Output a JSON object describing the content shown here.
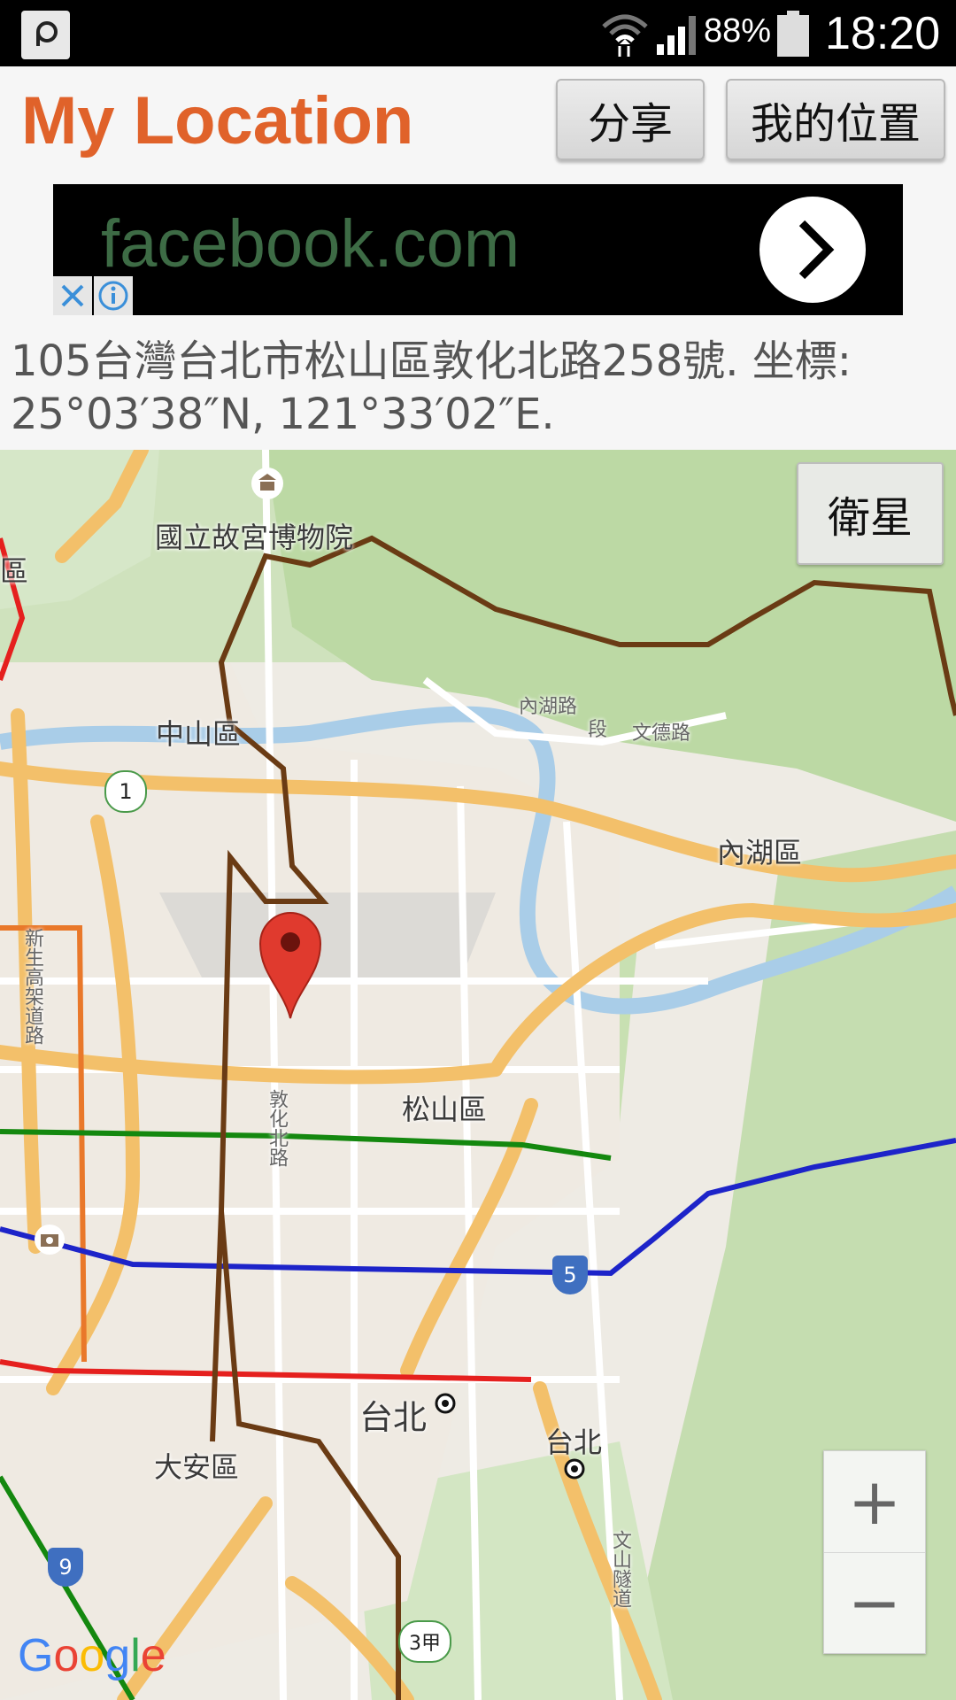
{
  "status_bar": {
    "battery": "88%",
    "time": "18:20"
  },
  "header": {
    "title": "My Location",
    "share_label": "分享",
    "my_location_label": "我的位置"
  },
  "ad": {
    "text": "facebook.com"
  },
  "address": "105台灣台北市松山區敦化北路258號. 坐標: 25°03′38″N, 121°33′02″E.",
  "map": {
    "satellite_label": "衛星",
    "labels": {
      "palace": "國立故宮博物院",
      "zhongshan": "中山區",
      "neihu": "內湖區",
      "songshan": "松山區",
      "taipei": "台北",
      "taipei2": "台北",
      "daan": "大安區",
      "district_edge": "區",
      "neihu_road": "內湖路",
      "section": "段",
      "wende_road": "文德路",
      "dunhua_road": "敦化北路",
      "xinsheng": "新生高架道路",
      "wenshan_tunnel": "文山隧道"
    },
    "shields": {
      "route1": "1",
      "route5": "5",
      "route9": "9",
      "route3": "3甲"
    },
    "zoom_in": "+",
    "zoom_out": "−",
    "google": [
      "G",
      "o",
      "o",
      "g",
      "l",
      "e"
    ]
  },
  "colors": {
    "title": "#e0622a",
    "ad_text": "#3d6b45",
    "marker": "#e03a2e"
  }
}
